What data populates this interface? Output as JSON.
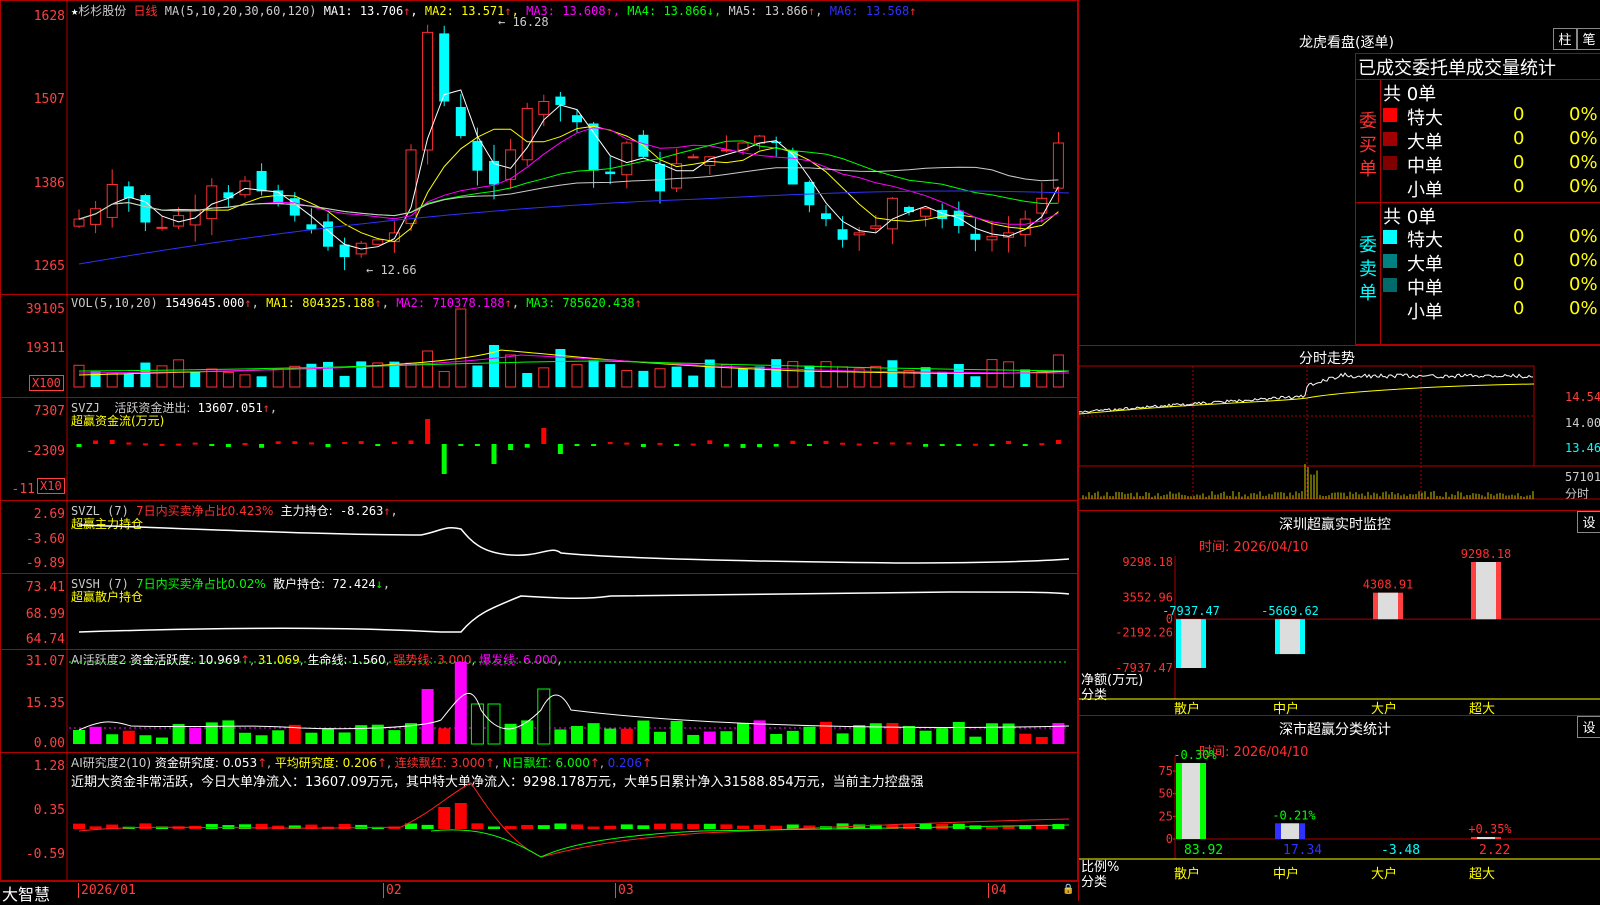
{
  "colors": {
    "up": "#ff3030",
    "down": "#00ffff",
    "ma1": "#ffffff",
    "ma2": "#ffff00",
    "ma3": "#ff00ff",
    "ma4": "#00ff00",
    "ma5": "#cccccc",
    "ma6": "#3030ff",
    "axis": "#ff4040",
    "grid": "#b00000"
  },
  "main": {
    "star": "★",
    "stock": "杉杉股份",
    "period": "日线",
    "ma_params": "MA(5,10,20,30,60,120)",
    "ma": [
      {
        "label": "MA1:",
        "value": "13.706",
        "arrow": "↑"
      },
      {
        "label": "MA2:",
        "value": "13.571",
        "arrow": "↑"
      },
      {
        "label": "MA3:",
        "value": "13.608",
        "arrow": "↑"
      },
      {
        "label": "MA4:",
        "value": "13.866",
        "arrow": "↓"
      },
      {
        "label": "MA5:",
        "value": "13.866",
        "arrow": "↑"
      },
      {
        "label": "MA6:",
        "value": "13.568",
        "arrow": "↑"
      }
    ],
    "yticks": [
      "1628",
      "1507",
      "1386",
      "1265"
    ],
    "high_note": "16.28",
    "low_note": "12.66"
  },
  "vol": {
    "title": "VOL(5,10,20)",
    "value": "1549645.000",
    "arrow": "↑",
    "ma": [
      {
        "label": "MA1:",
        "value": "804325.188",
        "arrow": "↑"
      },
      {
        "label": "MA2:",
        "value": "710378.188",
        "arrow": "↑"
      },
      {
        "label": "MA3:",
        "value": "785620.438",
        "arrow": "↑"
      }
    ],
    "yticks": [
      "39105",
      "19311"
    ],
    "unit": "X100"
  },
  "svzj": {
    "title": "SVZJ",
    "label": "活跃资金进出:",
    "value": "13607.051",
    "arrow": "↑",
    "sub": "超赢资金流(万元)",
    "yticks": [
      "7307",
      "-2309",
      "-11"
    ],
    "unit": "X10"
  },
  "svzl": {
    "title": "SVZL (7)",
    "ratio": "7日内买卖净占比0.423%",
    "label": "主力持仓:",
    "value": "-8.263",
    "arrow": "↑",
    "sub": "超赢主力持仓",
    "yticks": [
      "2.69",
      "-3.60",
      "-9.89"
    ]
  },
  "svsh": {
    "title": "SVSH (7)",
    "ratio": "7日内买卖净占比0.02%",
    "label": "散户持仓:",
    "value": "72.424",
    "arrow": "↓",
    "sub": "超赢散户持仓",
    "yticks": [
      "73.41",
      "68.99",
      "64.74"
    ]
  },
  "ai1": {
    "title": "AI活跃度2",
    "label": "资金活跃度:",
    "value": "10.969",
    "arrow": "↑",
    "v2": "31.069",
    "v3label": "生命线:",
    "v3": "1.560",
    "strong": "强势线: 3.000",
    "burst": "爆发线: 6.000",
    "yticks": [
      "31.07",
      "15.35",
      "0.00"
    ]
  },
  "ai2": {
    "title": "AI研究度2(10)",
    "label": "资金研究度:",
    "value": "0.053",
    "arrow": "↑",
    "avg_label": "平均研究度:",
    "avg": "0.206",
    "red_label": "连续飘红:",
    "red": "3.000",
    "n_label": "N日飘红:",
    "n": "6.000",
    "v5": "0.206",
    "desc": "近期大资金非常活跃，今日大单净流入：13607.09万元，其中特大单净流入：9298.178万元，大单5日累计净入31588.854万元，当前主力控盘强",
    "yticks": [
      "1.28",
      "0.35",
      "-0.59"
    ]
  },
  "bottom": {
    "brand": "大智慧",
    "months": [
      "2026/01",
      "02",
      "03",
      "04"
    ]
  },
  "longhu": {
    "title": "龙虎看盘(逐单)",
    "btn1": "柱",
    "btn2": "笔",
    "header": "已成交委托单成交量统计",
    "buy": {
      "side": [
        "委",
        "买",
        "单"
      ],
      "total": "共 0单",
      "rows": [
        {
          "name": "特大",
          "v": "0",
          "p": "0%",
          "c": "#ff0000"
        },
        {
          "name": "大单",
          "v": "0",
          "p": "0%",
          "c": "#a00000"
        },
        {
          "name": "中单",
          "v": "0",
          "p": "0%",
          "c": "#800000"
        },
        {
          "name": "小单",
          "v": "0",
          "p": "0%",
          "c": ""
        }
      ]
    },
    "sell": {
      "side": [
        "委",
        "卖",
        "单"
      ],
      "total": "共 0单",
      "rows": [
        {
          "name": "特大",
          "v": "0",
          "p": "0%",
          "c": "#00ffff"
        },
        {
          "name": "大单",
          "v": "0",
          "p": "0%",
          "c": "#008080"
        },
        {
          "name": "中单",
          "v": "0",
          "p": "0%",
          "c": "#006a6a"
        },
        {
          "name": "小单",
          "v": "0",
          "p": "0%",
          "c": ""
        }
      ]
    }
  },
  "fenshi": {
    "title": "分时走势",
    "yticks": [
      "14.54",
      "14.00",
      "13.46",
      "57101"
    ],
    "unit": "分时"
  },
  "sz_monitor": {
    "title": "深圳超赢实时监控",
    "btn": "设",
    "time": "时间: 2026/04/10",
    "yticks": [
      "9298.18",
      "3552.96",
      "0",
      "-2192.26",
      "-7937.47"
    ],
    "ylabel": "净额(万元)",
    "xlabel": "分类",
    "bars": [
      {
        "name": "散户",
        "value": -7937.47,
        "label": "-7937.47"
      },
      {
        "name": "中户",
        "value": -5669.62,
        "label": "-5669.62"
      },
      {
        "name": "大户",
        "value": 4308.91,
        "label": "4308.91"
      },
      {
        "name": "超大",
        "value": 9298.18,
        "label": "9298.18"
      }
    ]
  },
  "sz_class": {
    "title": "深市超赢分类统计",
    "btn": "设",
    "time": "时间: 2026/04/10",
    "yticks": [
      "75",
      "50",
      "25",
      "0"
    ],
    "ylabel": "比例%",
    "xlabel": "分类",
    "bars": [
      {
        "name": "散户",
        "value": 83.92,
        "label": "83.92",
        "chg": "-0.30%"
      },
      {
        "name": "中户",
        "value": 17.34,
        "label": "17.34",
        "chg": "-0.21%"
      },
      {
        "name": "大户",
        "value": -3.48,
        "label": "-3.48",
        "chg": ""
      },
      {
        "name": "超大",
        "value": 2.22,
        "label": "2.22",
        "chg": "+0.35%"
      }
    ]
  }
}
